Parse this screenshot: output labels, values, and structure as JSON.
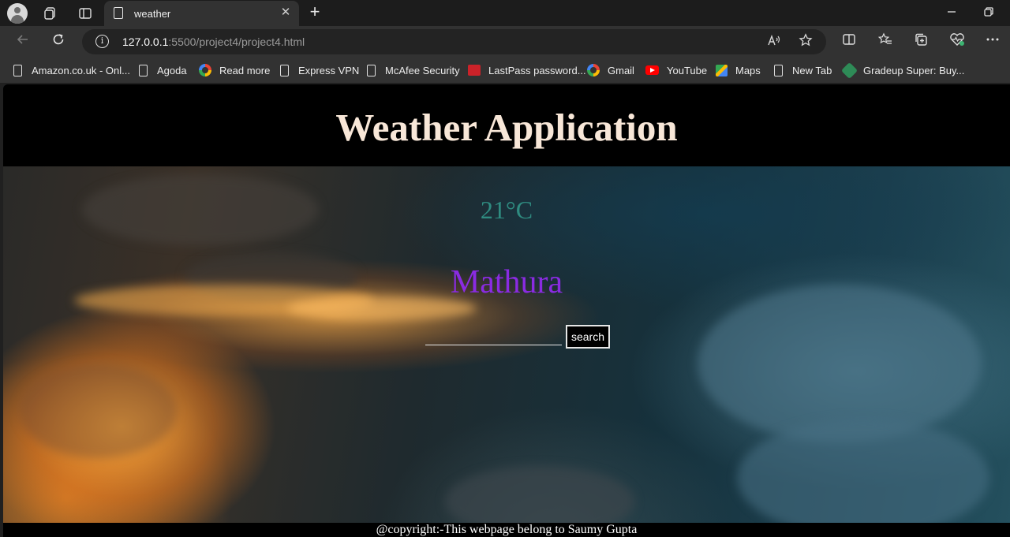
{
  "browser": {
    "tab_title": "weather",
    "tab_close_glyph": "✕",
    "new_tab_glyph": "+",
    "url_host": "127.0.0.1",
    "url_rest": ":5500/project4/project4.html",
    "icons": [
      "profile-icon",
      "workspaces-icon",
      "tab-actions-icon",
      "page-icon",
      "close-icon",
      "new-tab-icon",
      "minimize-icon",
      "restore-icon",
      "back-icon",
      "refresh-icon",
      "info-icon",
      "read-aloud-icon",
      "favorite-icon",
      "split-screen-icon",
      "favorites-icon",
      "collections-icon",
      "browser-essentials-icon",
      "more-icon"
    ]
  },
  "bookmarks": [
    {
      "label": "Amazon.co.uk - Onl...",
      "icon": "page-icon"
    },
    {
      "label": "Agoda",
      "icon": "page-icon"
    },
    {
      "label": "Read more",
      "icon": "google-icon"
    },
    {
      "label": "Express VPN",
      "icon": "page-icon"
    },
    {
      "label": "McAfee Security",
      "icon": "page-icon"
    },
    {
      "label": "LastPass password...",
      "icon": "lastpass-icon"
    },
    {
      "label": "Gmail",
      "icon": "google-icon"
    },
    {
      "label": "YouTube",
      "icon": "youtube-icon"
    },
    {
      "label": "Maps",
      "icon": "maps-icon"
    },
    {
      "label": "New Tab",
      "icon": "page-icon"
    },
    {
      "label": "Gradeup Super: Buy...",
      "icon": "gradeup-icon"
    }
  ],
  "page": {
    "title": "Weather Application",
    "temperature": "21°C",
    "city": "Mathura",
    "search_value": "",
    "search_button": "search",
    "footer": "@copyright:-This webpage belong to Saumy Gupta"
  },
  "colors": {
    "title": "#f8e7d8",
    "temperature": "#2f8b80",
    "city": "#8a2be2",
    "header_bg": "#000000"
  }
}
